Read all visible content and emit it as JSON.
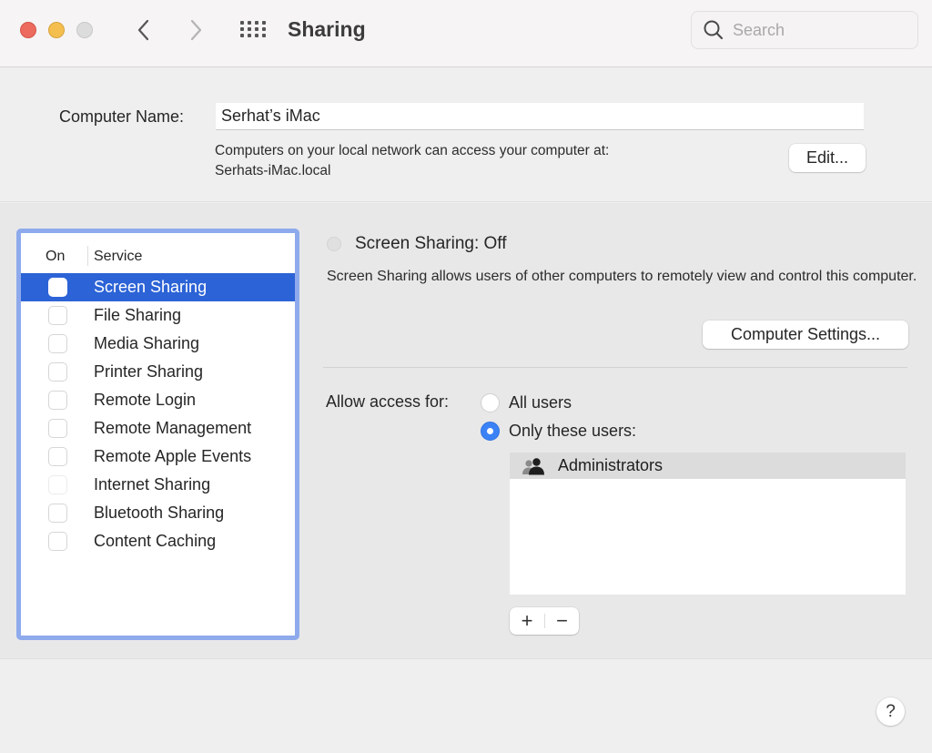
{
  "window": {
    "title": "Sharing",
    "search_placeholder": "Search"
  },
  "computer_name": {
    "label": "Computer Name:",
    "value": "Serhat’s iMac",
    "info_line1": "Computers on your local network can access your computer at:",
    "info_line2": "Serhats-iMac.local",
    "edit_label": "Edit..."
  },
  "services": {
    "header_on": "On",
    "header_service": "Service",
    "items": [
      {
        "label": "Screen Sharing",
        "checked": false,
        "selected": true
      },
      {
        "label": "File Sharing",
        "checked": false
      },
      {
        "label": "Media Sharing",
        "checked": false
      },
      {
        "label": "Printer Sharing",
        "checked": false
      },
      {
        "label": "Remote Login",
        "checked": false
      },
      {
        "label": "Remote Management",
        "checked": false
      },
      {
        "label": "Remote Apple Events",
        "checked": false
      },
      {
        "label": "Internet Sharing",
        "checked": false,
        "disabled": true
      },
      {
        "label": "Bluetooth Sharing",
        "checked": false
      },
      {
        "label": "Content Caching",
        "checked": false
      }
    ]
  },
  "detail": {
    "status": "Screen Sharing: Off",
    "description": "Screen Sharing allows users of other computers to remotely view and control this computer.",
    "computer_settings_label": "Computer Settings...",
    "access_label": "Allow access for:",
    "option_all": "All users",
    "option_only": "Only these users:",
    "selected_option": "Only these users:",
    "users": [
      "Administrators"
    ],
    "add_label": "+",
    "remove_label": "−"
  },
  "help_label": "?",
  "colors": {
    "selection": "#2c63d6",
    "focus_ring": "#8eaaec",
    "radio_on": "#3b82f6"
  }
}
